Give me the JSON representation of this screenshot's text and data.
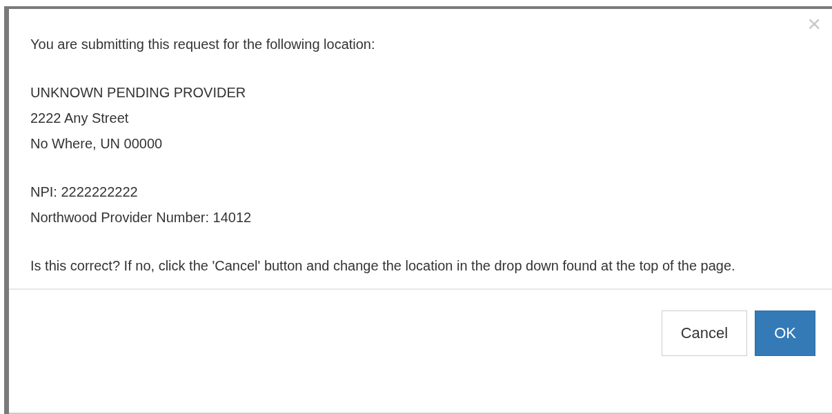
{
  "dialog": {
    "close": "×",
    "intro": "You are submitting this request for the following location:",
    "address_lines": [
      "UNKNOWN PENDING PROVIDER",
      "2222 Any Street",
      "No Where, UN 00000"
    ],
    "id_lines": [
      "NPI: 2222222222",
      "Northwood Provider Number: 14012"
    ],
    "question": "Is this correct? If no, click the 'Cancel' button and change the location in the drop down found at the top of the page.",
    "buttons": [
      {
        "label": "Cancel",
        "kind": "default"
      },
      {
        "label": "OK",
        "kind": "primary"
      }
    ]
  }
}
